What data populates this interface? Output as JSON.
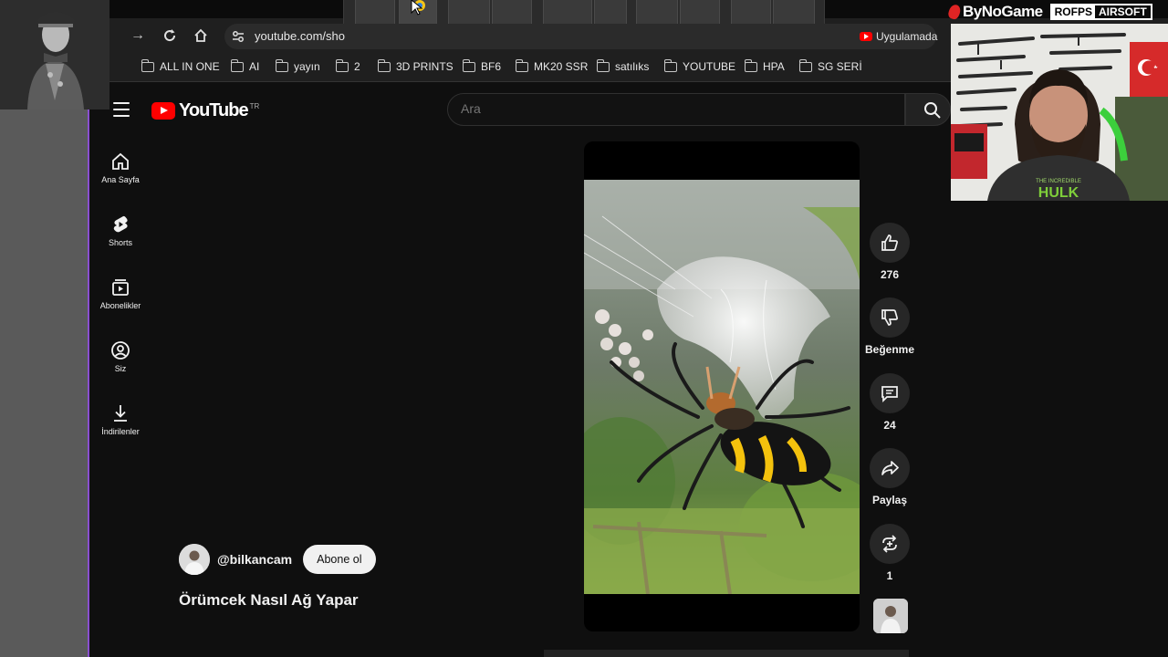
{
  "browser": {
    "url": "youtube.com/sho",
    "extension_label": "Uygulamada",
    "bookmarks": [
      "ALL IN ONE",
      "AI",
      "yayın",
      "2",
      "3D PRINTS",
      "BF6",
      "MK20 SSR",
      "satılıks",
      "YOUTUBE",
      "HPA",
      "SG SERİ"
    ]
  },
  "youtube": {
    "logo_text": "YouTube",
    "country_code": "TR",
    "search_placeholder": "Ara",
    "sidebar": [
      {
        "label": "Ana Sayfa",
        "icon": "home-icon"
      },
      {
        "label": "Shorts",
        "icon": "shorts-icon"
      },
      {
        "label": "Abonelikler",
        "icon": "subscriptions-icon"
      },
      {
        "label": "Siz",
        "icon": "you-icon"
      },
      {
        "label": "İndirilenler",
        "icon": "downloads-icon"
      }
    ],
    "short": {
      "channel": "@bilkancam",
      "subscribe_label": "Abone ol",
      "title": "Örümcek Nasıl Ağ Yapar"
    },
    "actions": {
      "like_count": "276",
      "dislike_label": "Beğenme",
      "comment_count": "24",
      "share_label": "Paylaş",
      "remix_count": "1"
    }
  },
  "overlay": {
    "brand_name": "ByNoGame",
    "sponsor_part1": "ROFPS",
    "sponsor_part2": "AIRSOFT",
    "shirt_text_1": "THE INCREDIBLE",
    "shirt_text_2": "HULK"
  },
  "colors": {
    "yt_red": "#ff0000",
    "background": "#0f0f0f",
    "accent_purple": "#8a4fd0"
  }
}
